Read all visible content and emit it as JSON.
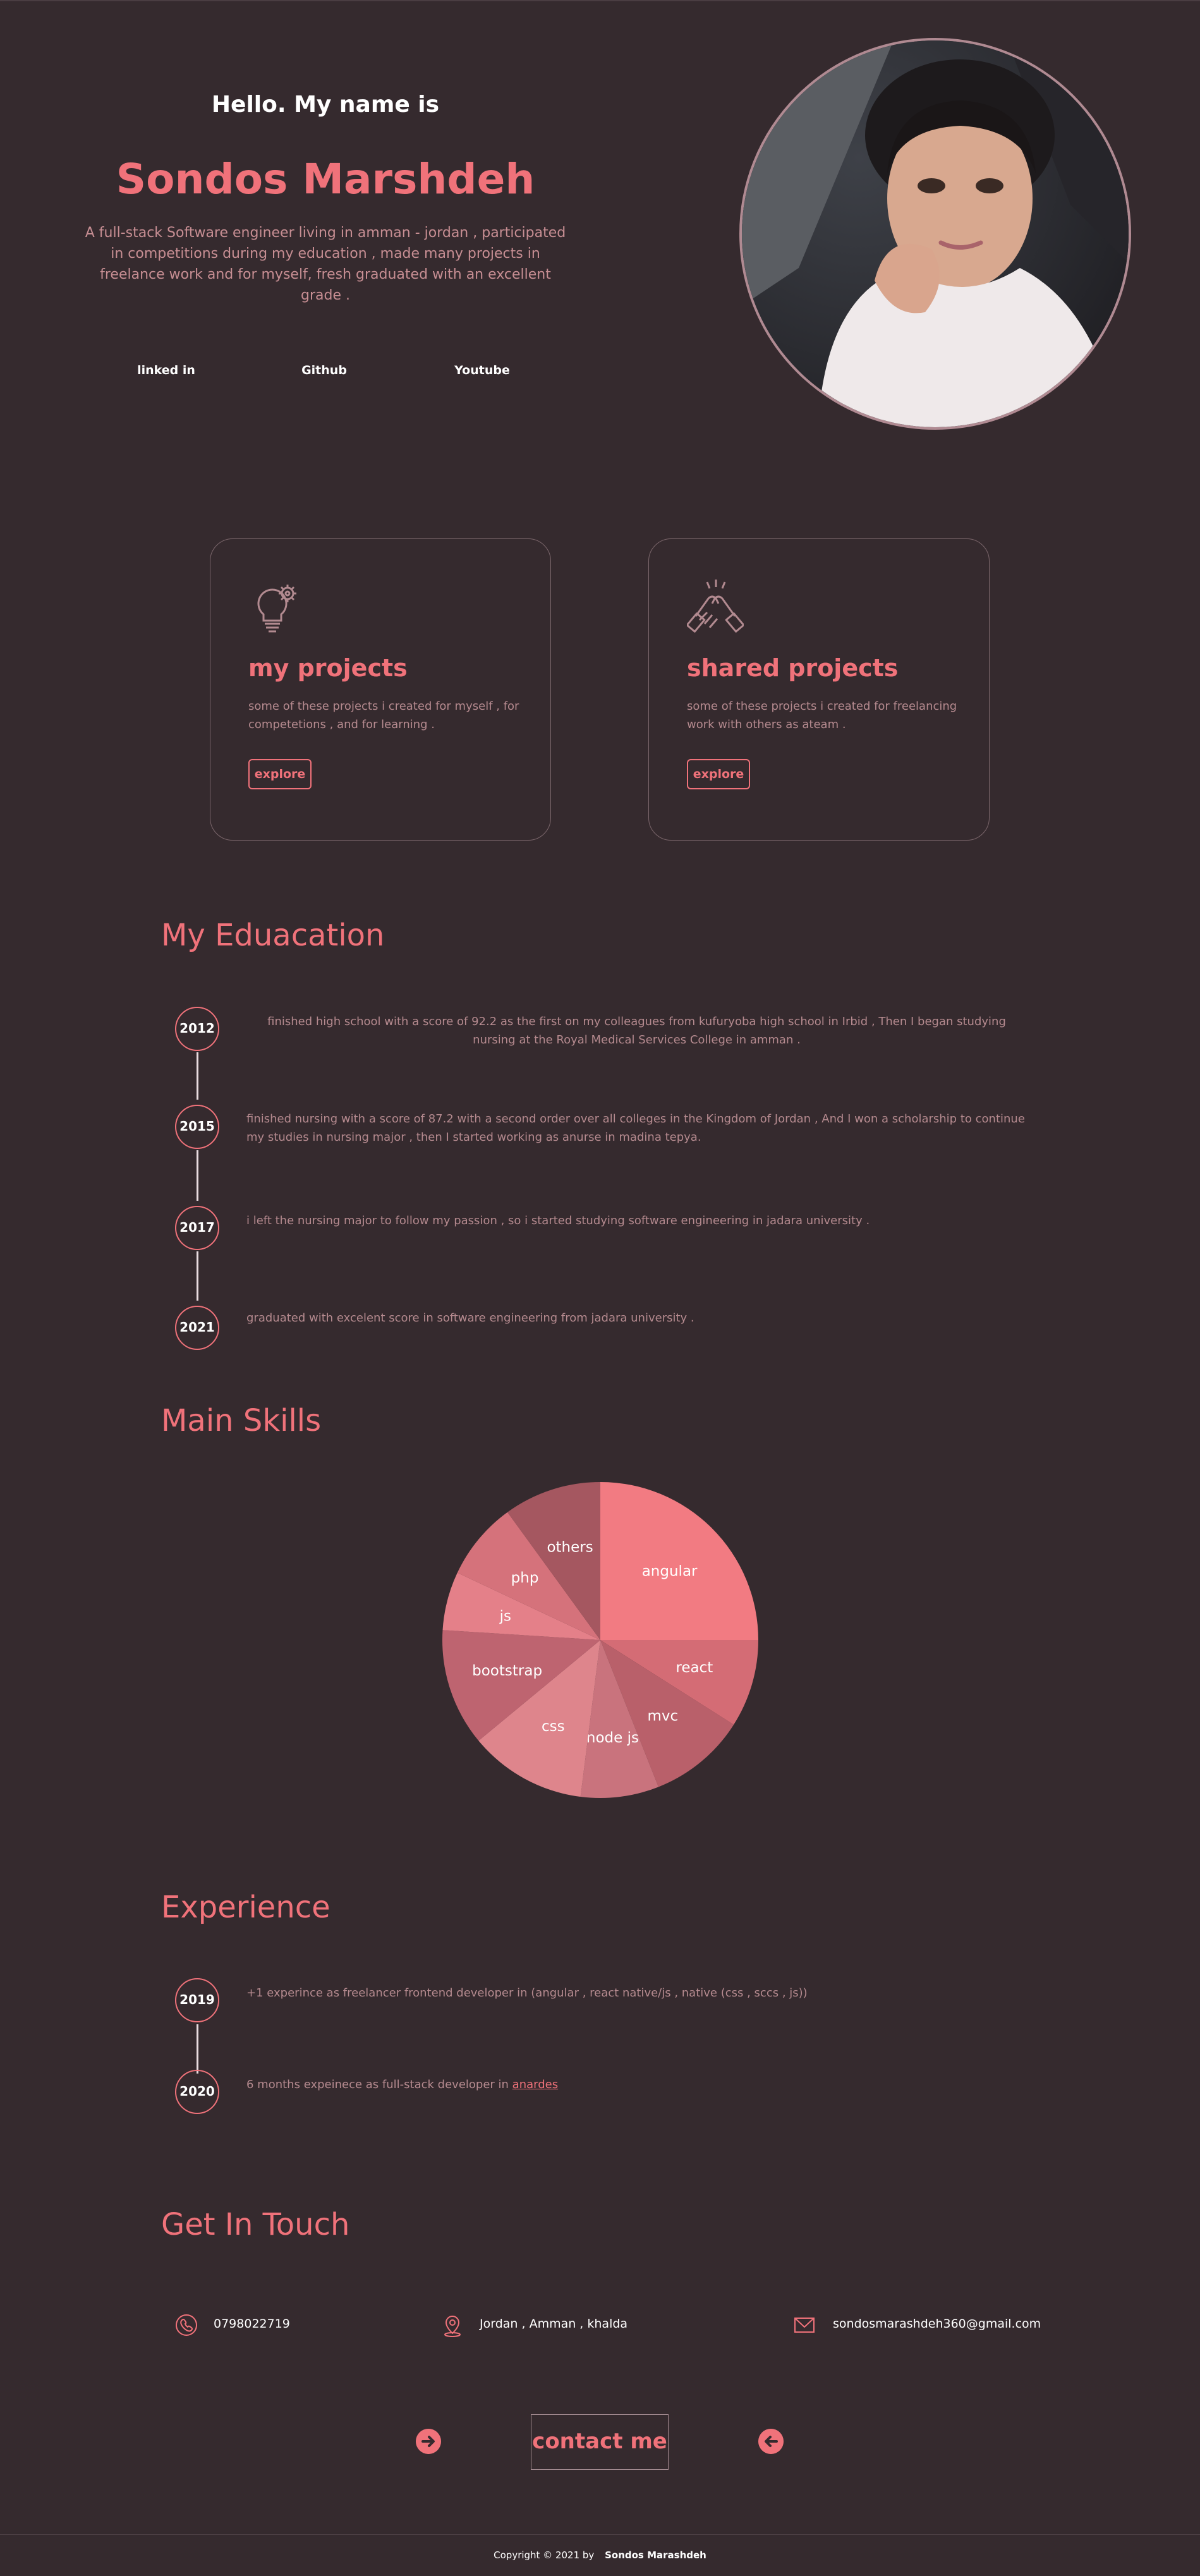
{
  "hero": {
    "greeting": "Hello. My name is",
    "name": "Sondos Marshdeh",
    "intro": "A full-stack Software engineer living in amman - jordan , participated in competitions during my education , made many projects in freelance work and for myself, fresh graduated with an excellent grade .",
    "links": [
      "linked in",
      "Github",
      "Youtube"
    ]
  },
  "cards": [
    {
      "title": "my projects",
      "desc": "some of these projects i created for myself , for competetions , and for learning .",
      "button": "explore",
      "icon": "lightbulb-gear-icon"
    },
    {
      "title": "shared projects",
      "desc": "some of these projects i created for freelancing work with others as ateam .",
      "button": "explore",
      "icon": "handshake-icon"
    }
  ],
  "education": {
    "heading": "My Eduacation",
    "items": [
      {
        "year": "2012",
        "text": "finished high school with a score of 92.2 as the first on my colleagues from kufuryoba high school in Irbid , Then I began studying nursing at the Royal Medical Services College in amman ."
      },
      {
        "year": "2015",
        "text": "finished nursing with a score of 87.2 with a second order over all colleges in the Kingdom of Jordan , And I won a scholarship to continue my studies in nursing major , then I started working as anurse in madina tepya."
      },
      {
        "year": "2017",
        "text": "i left the nursing major to follow my passion , so i started studying software engineering in jadara university ."
      },
      {
        "year": "2021",
        "text": "graduated with excelent score in software engineering from jadara university ."
      }
    ]
  },
  "skills": {
    "heading": "Main Skills"
  },
  "chart_data": {
    "type": "pie",
    "categories": [
      "angular",
      "react",
      "mvc",
      "node js",
      "css",
      "bootstrap",
      "js",
      "php",
      "others"
    ],
    "values": [
      25,
      9,
      10,
      8,
      12,
      12,
      6,
      8,
      10
    ],
    "colors": [
      "#f27b82",
      "#d46c75",
      "#b9606a",
      "#c9737d",
      "#de858c",
      "#be6470",
      "#e48089",
      "#d5727b",
      "#a55760"
    ]
  },
  "experience": {
    "heading": "Experience",
    "items": [
      {
        "year": "2019",
        "text": "+1 experince as freelancer frontend developer in (angular , react native/js , native (css , sccs , js))"
      },
      {
        "year": "2020",
        "text": "6 months expeinece as full-stack developer in",
        "link": "anardes"
      }
    ]
  },
  "contact": {
    "heading": "Get In Touch",
    "phone": "0798022719",
    "location": "Jordan , Amman , khalda",
    "email": "sondosmarashdeh360@gmail.com",
    "button": "contact me"
  },
  "footer": {
    "text": "Copyright © 2021 by",
    "author": "Sondos Marashdeh"
  }
}
